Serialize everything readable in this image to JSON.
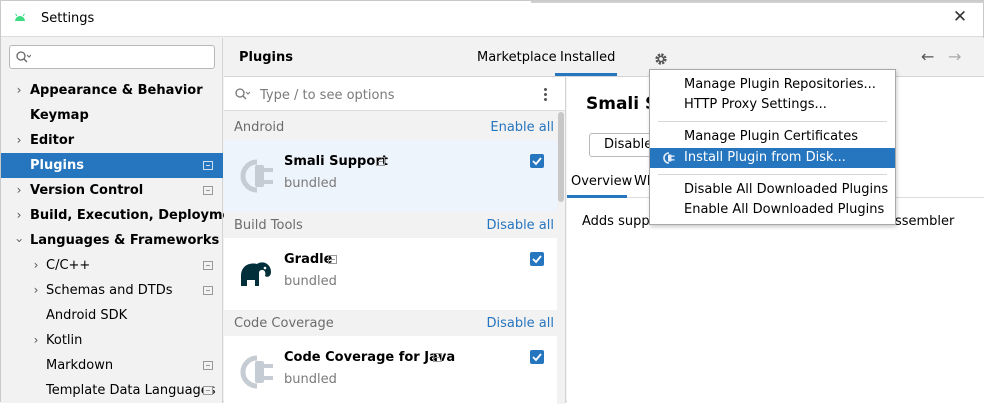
{
  "window": {
    "title": "Settings"
  },
  "sidebar": {
    "search_placeholder": "",
    "items": [
      {
        "label": "Appearance & Behavior"
      },
      {
        "label": "Keymap"
      },
      {
        "label": "Editor"
      },
      {
        "label": "Plugins"
      },
      {
        "label": "Version Control"
      },
      {
        "label": "Build, Execution, Deployment"
      },
      {
        "label": "Languages & Frameworks"
      },
      {
        "label": "C/C++"
      },
      {
        "label": "Schemas and DTDs"
      },
      {
        "label": "Android SDK"
      },
      {
        "label": "Kotlin"
      },
      {
        "label": "Markdown"
      },
      {
        "label": "Template Data Languages"
      }
    ]
  },
  "header": {
    "title": "Plugins",
    "tabs": [
      {
        "label": "Marketplace"
      },
      {
        "label": "Installed"
      }
    ],
    "active_tab": "Installed",
    "back": "←",
    "forward": "→"
  },
  "plugin_list": {
    "search_placeholder": "Type / to see options",
    "groups": [
      {
        "name": "Android",
        "action": "Enable all",
        "plugins": [
          {
            "name": "Smali Support",
            "sub": "bundled",
            "enabled": true
          }
        ]
      },
      {
        "name": "Build Tools",
        "action": "Disable all",
        "plugins": [
          {
            "name": "Gradle",
            "sub": "bundled",
            "enabled": true
          }
        ]
      },
      {
        "name": "Code Coverage",
        "action": "Disable all",
        "plugins": [
          {
            "name": "Code Coverage for Java",
            "sub": "bundled",
            "enabled": true
          }
        ]
      }
    ]
  },
  "details": {
    "title": "Smali S",
    "disable_button": "Disable",
    "tabs": [
      {
        "label": "Overview"
      },
      {
        "label": "Wh"
      }
    ],
    "description": "Adds suppo",
    "description_tail": "assembler"
  },
  "menu": {
    "items": [
      {
        "label": "Manage Plugin Repositories..."
      },
      {
        "label": "HTTP Proxy Settings..."
      },
      {
        "label": "Manage Plugin Certificates"
      },
      {
        "label": "Install Plugin from Disk..."
      },
      {
        "label": "Disable All Downloaded Plugins"
      },
      {
        "label": "Enable All Downloaded Plugins"
      }
    ],
    "selected": "Install Plugin from Disk..."
  },
  "colors": {
    "accent": "#2675bf",
    "link": "#2675bf",
    "android_green": "#3ddc84",
    "gradle_dark": "#02303a"
  }
}
